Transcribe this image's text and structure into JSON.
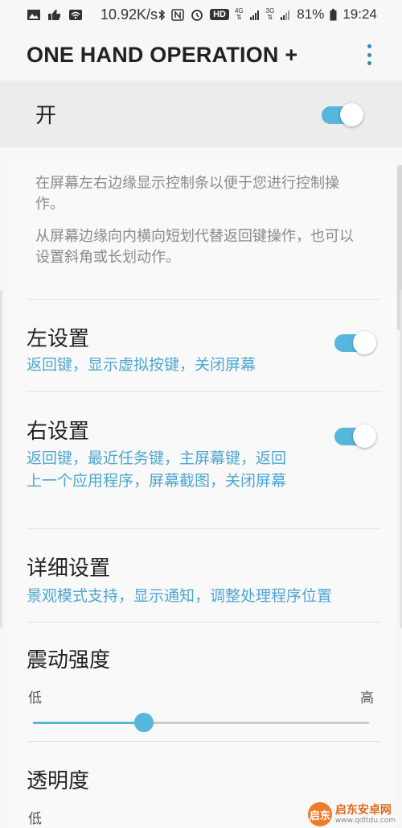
{
  "status_bar": {
    "net_speed": "10.92K/s",
    "hd_badge": "HD",
    "net_4g": "4G",
    "net_3g": "3G",
    "battery": "81%",
    "time": "19:24",
    "icons": [
      "image-icon",
      "thumbs-up-icon",
      "wifi-icon",
      "bluetooth-icon",
      "nfc-icon",
      "alarm-icon",
      "signal-icon",
      "battery-icon"
    ]
  },
  "app_bar": {
    "title": "ONE HAND OPERATION +",
    "more_icon": "more-vert-icon"
  },
  "master": {
    "label": "开",
    "enabled": true
  },
  "description": {
    "line1": "在屏幕左右边缘显示控制条以便于您进行控制操作。",
    "line2": "从屏幕边缘向内横向短划代替返回键操作，也可以设置斜角或长划动作。"
  },
  "settings": {
    "left": {
      "title": "左设置",
      "summary": "返回键，显示虚拟按键，关闭屏幕",
      "enabled": true
    },
    "right": {
      "title": "右设置",
      "summary": "返回键，最近任务键，主屏幕键，返回上一个应用程序，屏幕截图，关闭屏幕",
      "enabled": true
    },
    "detail": {
      "title": "详细设置",
      "summary": "景观模式支持，显示通知，调整处理程序位置"
    },
    "vibration": {
      "title": "震动强度",
      "low_label": "低",
      "high_label": "高",
      "level_fraction": 0.33
    },
    "transparency": {
      "title": "透明度",
      "low_label": "低"
    }
  },
  "watermark": {
    "logo_text": "启东",
    "name": "启东安卓网",
    "url": "www.qdltdu.com"
  },
  "colors": {
    "accent": "#56b6dc",
    "summary": "#4ea7cf",
    "title_text": "#222222",
    "desc_text": "#8a8a8a"
  }
}
